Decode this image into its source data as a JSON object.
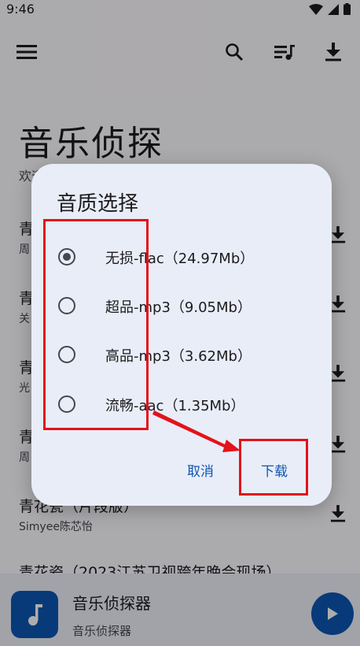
{
  "status_bar": {
    "time": "9:46"
  },
  "header": {
    "menu_icon": "menu-icon",
    "search_icon": "search-icon",
    "playlist_icon": "playlist-icon",
    "download_icon": "download-icon"
  },
  "page": {
    "title": "音乐侦探",
    "subtitle": "欢迎"
  },
  "songs": [
    {
      "title": "青",
      "artist": "周"
    },
    {
      "title": "青",
      "artist": "关"
    },
    {
      "title": "青",
      "artist": "光"
    },
    {
      "title": "青",
      "artist": "周"
    },
    {
      "title": "青花瓷（片段版）",
      "artist": "Simyee陈芯怡"
    },
    {
      "title": "青花瓷（2023江苏卫视跨年晚会现场）",
      "artist": ""
    }
  ],
  "player": {
    "title": "音乐侦探器",
    "subtitle": "音乐侦探器"
  },
  "dialog": {
    "title": "音质选择",
    "options": [
      {
        "label": "无损-flac（24.97Mb）",
        "selected": true
      },
      {
        "label": "超品-mp3（9.05Mb）",
        "selected": false
      },
      {
        "label": "高品-mp3（3.62Mb）",
        "selected": false
      },
      {
        "label": "流畅-aac（1.35Mb）",
        "selected": false
      }
    ],
    "cancel_label": "取消",
    "confirm_label": "下载"
  },
  "colors": {
    "accent": "#0d56b3",
    "highlight": "#e3121b"
  }
}
